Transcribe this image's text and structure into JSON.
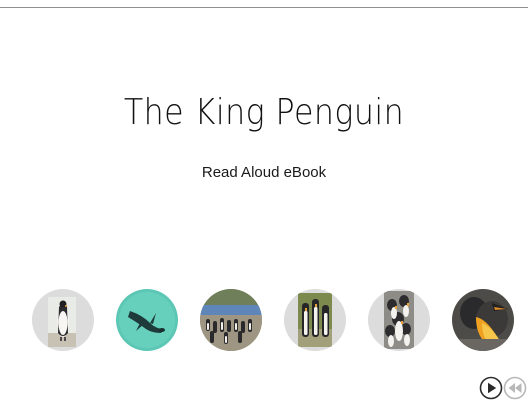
{
  "book": {
    "title": "The King Penguin",
    "subtitle": "Read Aloud eBook"
  },
  "thumbnails": [
    {
      "name": "single-penguin-standing"
    },
    {
      "name": "penguin-swimming-underwater"
    },
    {
      "name": "penguin-colony-on-beach"
    },
    {
      "name": "penguin-group-on-grass"
    },
    {
      "name": "penguin-crowd-closeup"
    },
    {
      "name": "penguin-head-closeup"
    }
  ],
  "controls": {
    "play_icon": "play-icon",
    "rewind_icon": "rewind-icon"
  }
}
